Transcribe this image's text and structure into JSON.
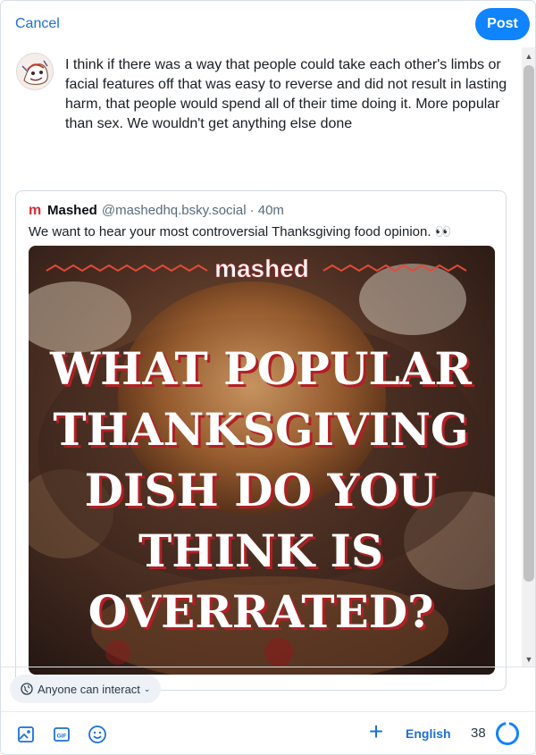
{
  "header": {
    "cancel_label": "Cancel",
    "post_label": "Post"
  },
  "post": {
    "text": "I think if there was a way that people could take each other's limbs or facial features off that was easy to reverse and did not result in lasting harm, that people would spend all of their time doing it. More popular than sex. We wouldn't get anything else done"
  },
  "quote": {
    "author_name": "Mashed",
    "handle": "@mashedhq.bsky.social",
    "time": "· 40m",
    "text": "We want to hear your most controversial Thanksgiving food opinion. 👀",
    "image": {
      "brand": "mashed",
      "headline": [
        "WHAT POPULAR",
        "THANKSGIVING",
        "DISH DO YOU",
        "THINK IS",
        "OVERRATED?"
      ]
    }
  },
  "footer": {
    "interact_label": "Anyone can interact",
    "language": "English",
    "remaining_chars": "38"
  },
  "colors": {
    "accent": "#1083fe",
    "link": "#1c6fdc",
    "brand_red": "#e0282e"
  }
}
